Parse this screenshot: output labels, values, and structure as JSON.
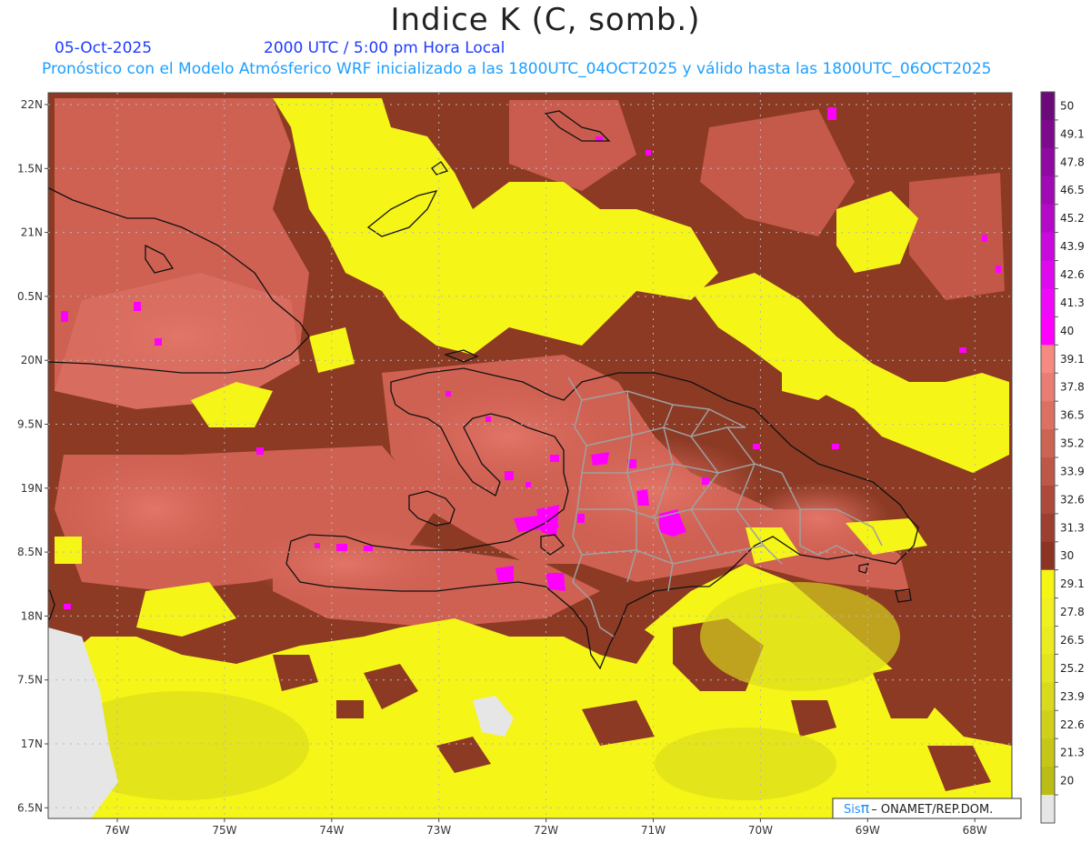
{
  "title": "Indice K (C, somb.)",
  "date": "05-Oct-2025",
  "time": "2000 UTC / 5:00 pm Hora Local",
  "info": "Pronóstico con el Modelo Atmósferico WRF inicializado a las 1800UTC_04OCT2025 y válido hasta las  1800UTC_06OCT2025",
  "lat_labels": [
    "22N",
    "1.5N",
    "21N",
    "0.5N",
    "20N",
    "9.5N",
    "19N",
    "8.5N",
    "18N",
    "7.5N",
    "17N",
    "6.5N"
  ],
  "lon_labels": [
    "76W",
    "75W",
    "74W",
    "73W",
    "72W",
    "71W",
    "70W",
    "69W",
    "68W"
  ],
  "colorbar": {
    "labels": [
      "50",
      "49.1",
      "47.8",
      "46.5",
      "45.2",
      "43.9",
      "42.6",
      "41.3",
      "40",
      "39.1",
      "37.8",
      "36.5",
      "35.2",
      "33.9",
      "32.6",
      "31.3",
      "30",
      "29.1",
      "27.8",
      "26.5",
      "25.2",
      "23.9",
      "22.6",
      "21.3",
      "20"
    ],
    "colors": [
      "#6b0a78",
      "#7d0a8c",
      "#8f0aa0",
      "#a00ab4",
      "#b40ac8",
      "#c80adc",
      "#dc0aec",
      "#ee0af8",
      "#ff00ff",
      "#f48a82",
      "#e87d73",
      "#db7063",
      "#cc6454",
      "#bd5748",
      "#ae4a3c",
      "#9c3f30",
      "#8c3423",
      "#f5f515",
      "#f0f021",
      "#ebeb22",
      "#e3e31e",
      "#dada1c",
      "#d0d01a",
      "#c6c618",
      "#bcbc16",
      "#e6e6e6"
    ]
  },
  "legend_colors": {
    "yellow": "#f5f518",
    "brown": "#8c3a24",
    "salmon": "#d9695c",
    "magenta": "#ff00ff",
    "no_data": "#e6e6e6"
  },
  "credit": {
    "sis": "Sis",
    "pi": "π",
    "rest": "– ONAMET/REP.DOM."
  }
}
